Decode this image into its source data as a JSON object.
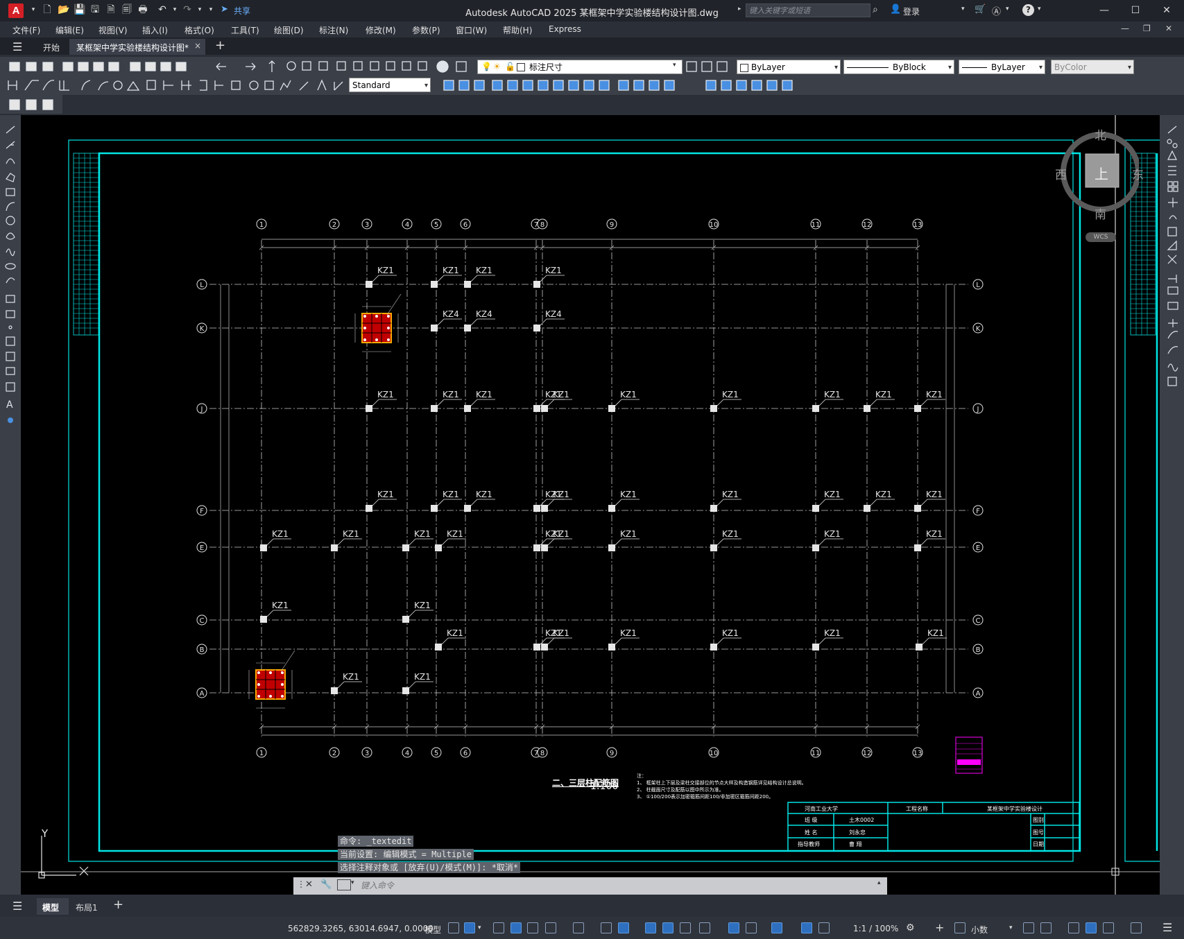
{
  "titlebar": {
    "app_logo": "A",
    "share_label": "共享",
    "title": "Autodesk AutoCAD 2025    某框架中学实验楼结构设计图.dwg",
    "search_placeholder": "键入关键字或短语",
    "login_label": "登录",
    "help_label": "?"
  },
  "menubar": {
    "items": [
      "文件(F)",
      "编辑(E)",
      "视图(V)",
      "插入(I)",
      "格式(O)",
      "工具(T)",
      "绘图(D)",
      "标注(N)",
      "修改(M)",
      "参数(P)",
      "窗口(W)",
      "帮助(H)",
      "Express"
    ]
  },
  "tabs": {
    "start": "开始",
    "document": "某框架中学实验楼结构设计图*",
    "close": "×",
    "add": "+"
  },
  "toolbar": {
    "layer_name": "标注尺寸",
    "color": "ByLayer",
    "linetype": "ByBlock",
    "lineweight": "ByLayer",
    "plotstyle": "ByColor",
    "text_style": "Standard"
  },
  "viewcube": {
    "north": "北",
    "south": "南",
    "east": "东",
    "west": "西",
    "top": "上",
    "wcs": "WCS"
  },
  "drawing": {
    "col_labels_x": [
      "1",
      "2",
      "3",
      "4",
      "5",
      "6",
      "7",
      "8",
      "9",
      "10",
      "11",
      "12",
      "13"
    ],
    "row_labels": [
      "L",
      "K",
      "J",
      "F",
      "E",
      "C",
      "B",
      "A"
    ],
    "column_tag": "KZ1",
    "column_tag_alt": "KZ4",
    "plan_title": "二、三层柱配筋图",
    "plan_scale": "1:100",
    "notes": [
      "注：",
      "1、 框架柱上下层及梁柱交接部位的节点大样及构造钢筋详见结构设计总说明。",
      "2、 柱截面尺寸及配筋以图中所示为准。",
      "3、 ①100/200表示加密箍筋间距100/非加密区箍筋间距200。"
    ],
    "title_block": {
      "school": "河南工业大学",
      "project_label": "工程名称",
      "project": "某框架中学实验楼设计",
      "r1": [
        "班 级",
        "土木0002"
      ],
      "r2": [
        "姓 名",
        "刘永忠"
      ],
      "r3": [
        "指导教师",
        "曹 翔"
      ],
      "side": [
        "图别",
        "图号",
        "日期"
      ]
    },
    "ucs_y": "Y"
  },
  "command": {
    "history": [
      "命令: _textedit",
      "当前设置: 编辑模式 = Multiple",
      "选择注释对象或 [放弃(U)/模式(M)]: *取消*"
    ],
    "placeholder": "键入命令"
  },
  "layout_tabs": [
    "模型",
    "布局1"
  ],
  "status": {
    "coords": "562829.3265, 63014.6947, 0.0000",
    "model": "模型",
    "scale": "1:1 / 100%",
    "units": "小数"
  }
}
